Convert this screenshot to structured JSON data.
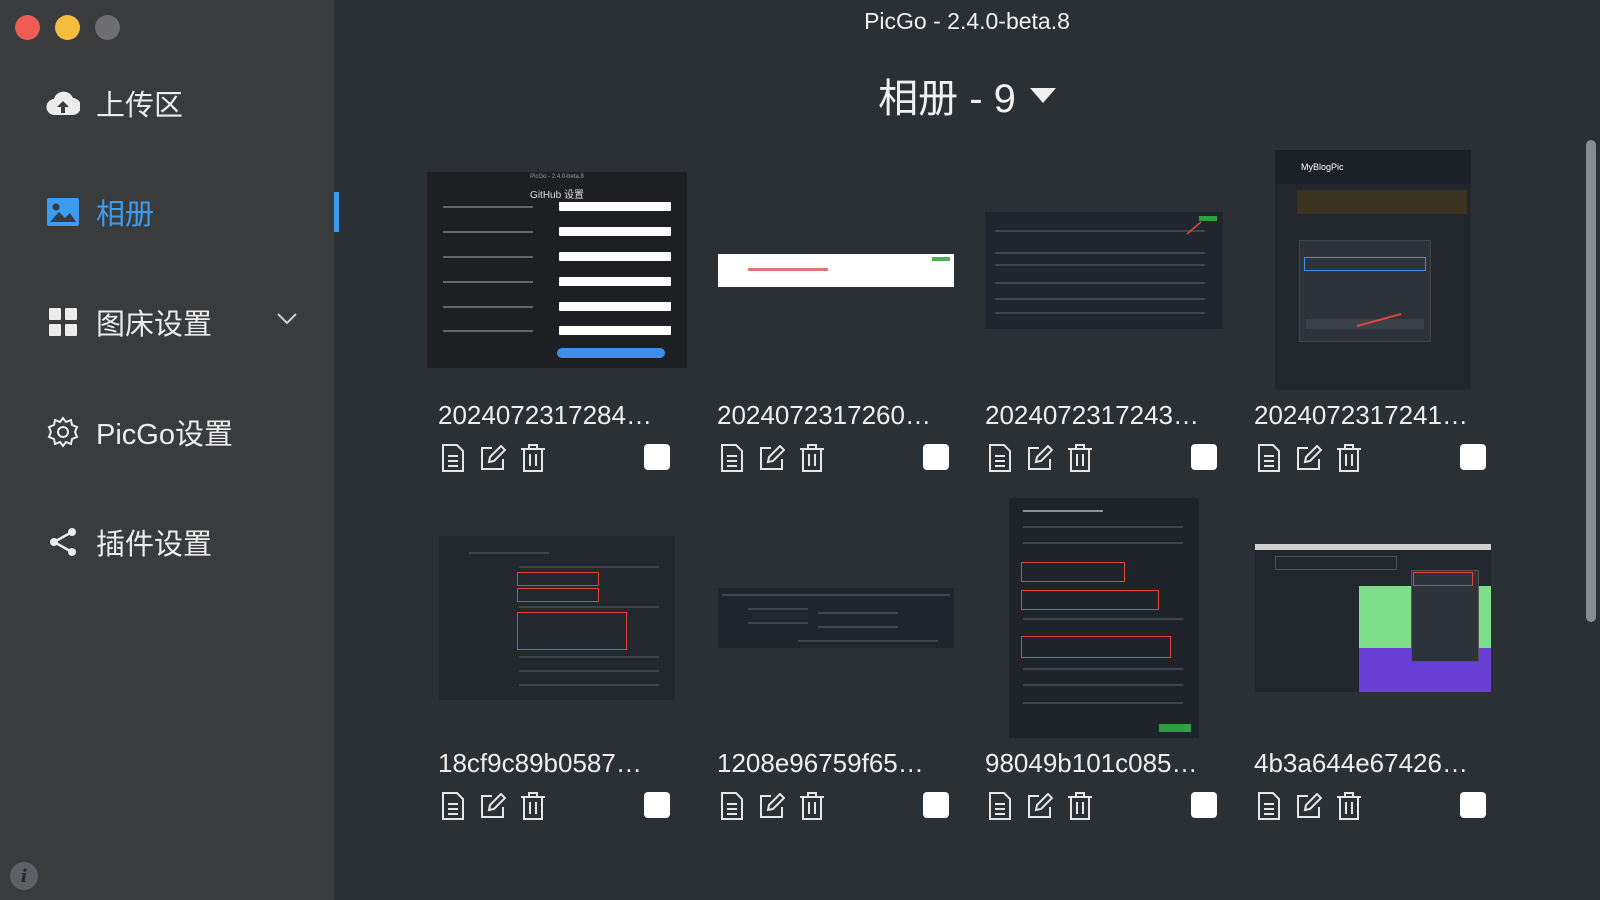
{
  "window": {
    "title": "PicGo - 2.4.0-beta.8"
  },
  "sidebar": {
    "items": [
      {
        "label": "上传区",
        "icon": "cloud-upload-icon"
      },
      {
        "label": "相册",
        "icon": "image-icon",
        "active": true
      },
      {
        "label": "图床设置",
        "icon": "grid-icon",
        "expandable": true
      },
      {
        "label": "PicGo设置",
        "icon": "gear-icon"
      },
      {
        "label": "插件设置",
        "icon": "share-icon"
      }
    ]
  },
  "album": {
    "title": "相册 - 9"
  },
  "images": [
    {
      "filename": "2024072317284…",
      "thumbnail": "github-settings-form"
    },
    {
      "filename": "2024072317260…",
      "thumbnail": "white-strip-screenshot"
    },
    {
      "filename": "2024072317243…",
      "thumbnail": "branches-screenshot"
    },
    {
      "filename": "2024072317241…",
      "thumbnail": "switch-branch-screenshot"
    },
    {
      "filename": "18cf9c89b0587…",
      "thumbnail": "token-settings-screenshot"
    },
    {
      "filename": "1208e96759f65…",
      "thumbnail": "developer-settings-screenshot"
    },
    {
      "filename": "98049b101c085…",
      "thumbnail": "create-repository-screenshot"
    },
    {
      "filename": "4b3a644e67426…",
      "thumbnail": "new-repository-menu-screenshot"
    }
  ],
  "colors": {
    "accent": "#3e9cf0",
    "sidebar_bg": "#3a3b3d",
    "main_bg": "#2b3034"
  }
}
